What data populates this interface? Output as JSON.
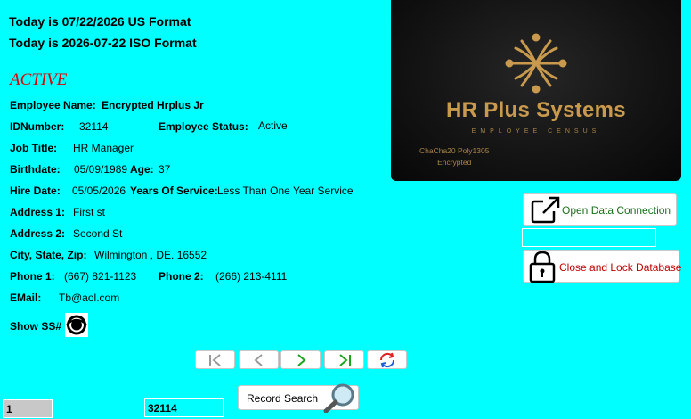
{
  "header": {
    "us_date": "Today is 07/22/2026 US Format",
    "iso_date": "Today is 2026-07-22 ISO Format",
    "status": "ACTIVE"
  },
  "employee": {
    "name_label": "Employee Name:",
    "name_value": "Encrypted  Hrplus Jr",
    "id_label": "IDNumber:",
    "id_value": "32114",
    "status_label": "Employee Status:",
    "status_value": "Active",
    "job_label": "Job Title:",
    "job_value": "HR Manager",
    "birth_label": "Birthdate:",
    "birth_value": "05/09/1989",
    "age_label": "Age:",
    "age_value": "37",
    "hire_label": "Hire Date:",
    "hire_value": "05/05/2026",
    "yos_label": "Years Of Service:",
    "yos_value": "Less Than One Year Service",
    "addr1_label": "Address 1:",
    "addr1_value": "First st",
    "addr2_label": "Address 2:",
    "addr2_value": "Second St",
    "csz_label": "City, State, Zip:",
    "csz_value": "Wilmington , DE. 16552",
    "phone1_label": "Phone 1:",
    "phone1_value": "(667) 821-1123",
    "phone2_label": "Phone 2:",
    "phone2_value": "(266) 213-4111",
    "email_label": "EMail:",
    "email_value": "Tb@aol.com",
    "ssn_label": "Show SS#"
  },
  "logo": {
    "title": "HR Plus Systems",
    "subtitle": "EMPLOYEE CENSUS",
    "enc_line1": "ChaCha20 Poly1305",
    "enc_line2": "Encrypted"
  },
  "actions": {
    "open_label": "Open Data Connection",
    "open_color": "#1a6e1a",
    "close_label": "Close and Lock Database",
    "close_color": "#c00000",
    "connection_field": ""
  },
  "navigation": {
    "icons": [
      "first-record-icon",
      "previous-record-icon",
      "next-record-icon",
      "last-record-icon",
      "refresh-icon"
    ]
  },
  "footer": {
    "record_number": "1",
    "search_value": "32114",
    "search_label": "Record Search"
  },
  "colors": {
    "background": "#00ffff",
    "status_red": "#e00000",
    "logo_gold": "#c99a4e",
    "nav_green": "#1aa51a",
    "refresh_red": "#e02020",
    "refresh_blue": "#1f5fd6"
  }
}
